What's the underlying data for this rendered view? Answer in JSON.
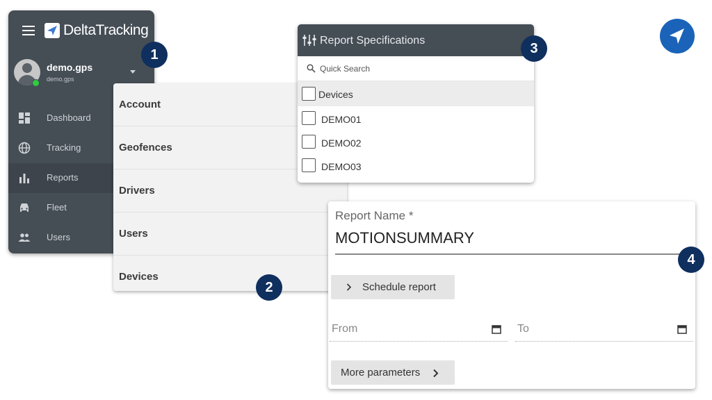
{
  "sidebar": {
    "logo_text": "DeltaTracking",
    "user": {
      "name": "demo.gps",
      "subtitle": "demo.gps"
    },
    "items": [
      {
        "label": "Dashboard",
        "icon": "dashboard-icon"
      },
      {
        "label": "Tracking",
        "icon": "globe-icon"
      },
      {
        "label": "Reports",
        "icon": "bar-chart-icon"
      },
      {
        "label": "Fleet",
        "icon": "car-icon"
      },
      {
        "label": "Users",
        "icon": "users-icon"
      }
    ]
  },
  "menu": {
    "items": [
      {
        "label": "Account"
      },
      {
        "label": "Geofences"
      },
      {
        "label": "Drivers"
      },
      {
        "label": "Users"
      },
      {
        "label": "Devices"
      }
    ]
  },
  "spec": {
    "title": "Report Specifications",
    "search_placeholder": "Quick Search",
    "devices_header": "Devices",
    "devices": [
      {
        "label": "DEMO01",
        "checked": false
      },
      {
        "label": "DEMO02",
        "checked": false
      },
      {
        "label": "DEMO03",
        "checked": false
      }
    ]
  },
  "form": {
    "report_name_label": "Report Name *",
    "report_name_value": "MOTIONSUMMARY",
    "schedule_button": "Schedule report",
    "from_label": "From",
    "to_label": "To",
    "more_params_button": "More parameters"
  },
  "badges": [
    "1",
    "2",
    "3",
    "4"
  ],
  "colors": {
    "sidebar_bg": "#454d55",
    "badge_bg": "#0f2f5e",
    "accent_blue": "#1a63b8",
    "online_green": "#2ecc40"
  }
}
